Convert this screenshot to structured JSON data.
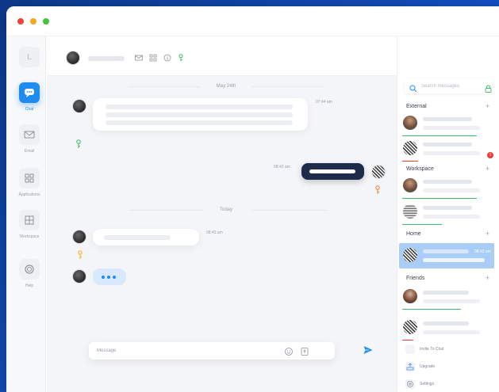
{
  "window": {
    "traffic_lights": [
      "close",
      "minimize",
      "zoom"
    ]
  },
  "nav": {
    "avatar_initial": "L",
    "items": [
      {
        "label": "Chat",
        "icon": "chat-bubble-icon",
        "active": true
      },
      {
        "label": "Email",
        "icon": "envelope-icon",
        "active": false
      },
      {
        "label": "Applications",
        "icon": "grid-icon",
        "active": false
      },
      {
        "label": "Workspace",
        "icon": "workspace-icon",
        "active": false
      },
      {
        "label": "Help",
        "icon": "help-ring-icon",
        "active": false
      }
    ]
  },
  "chat": {
    "header": {
      "icons": [
        "envelope-icon",
        "grid-icon",
        "info-icon",
        "key-icon"
      ],
      "right_icons": [
        "shuffle-icon",
        "compose-icon"
      ]
    },
    "date_separators": [
      "May 24th",
      "Today"
    ],
    "timestamps": [
      "07:44 am",
      "08:43 am",
      "08:43 am"
    ],
    "composer": {
      "placeholder": "Message"
    }
  },
  "sidebar": {
    "search_placeholder": "Search messages",
    "sections": [
      {
        "title": "External"
      },
      {
        "title": "Workspace"
      },
      {
        "title": "Home"
      },
      {
        "title": "Friends"
      }
    ],
    "home_selected_time": "08:43 am",
    "unread_badge": "1",
    "footer": [
      {
        "label": "Invite To Chat",
        "icon": "invite-icon"
      },
      {
        "label": "Upgrade",
        "icon": "upgrade-icon"
      },
      {
        "label": "Settings",
        "icon": "settings-icon"
      }
    ]
  },
  "colors": {
    "accent": "#1f8bf0",
    "background_gradient_start": "#0d3a8c",
    "background_gradient_end": "#1250c2",
    "key_green": "#3cc06b",
    "key_orange": "#f08a3c",
    "key_yellow": "#f4b52a",
    "status_green": "#3cc06b",
    "status_red": "#ef3b36"
  }
}
